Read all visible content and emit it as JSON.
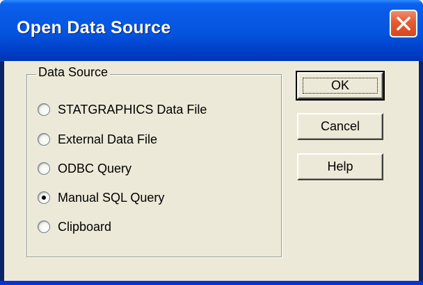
{
  "window": {
    "title": "Open Data Source"
  },
  "colors": {
    "titlebar": "#0454df",
    "close_button": "#e35b34",
    "dialog_face": "#ece9d8"
  },
  "icons": {
    "close": "close-icon"
  },
  "data_source": {
    "label": "Data Source",
    "selected": "Manual SQL Query",
    "options": [
      {
        "label": "STATGRAPHICS Data File",
        "checked": false
      },
      {
        "label": "External Data File",
        "checked": false
      },
      {
        "label": "ODBC Query",
        "checked": false
      },
      {
        "label": "Manual SQL Query",
        "checked": true
      },
      {
        "label": "Clipboard",
        "checked": false
      }
    ]
  },
  "buttons": {
    "ok": "OK",
    "cancel": "Cancel",
    "help": "Help"
  }
}
